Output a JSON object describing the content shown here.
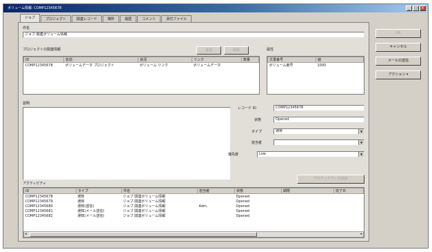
{
  "window": {
    "title": "ボリューム情報: COMP12345678"
  },
  "tabs": [
    {
      "label": "ジョブ"
    },
    {
      "label": "プロジェクト"
    },
    {
      "label": "関連レコード"
    },
    {
      "label": "場所"
    },
    {
      "label": "履歴"
    },
    {
      "label": "コメント"
    },
    {
      "label": "添付ファイル"
    }
  ],
  "main": {
    "subject_label": "件名",
    "subject_value": "ジョブ 関連ボリューム情報",
    "related_label": "プロジェクトの関連情報",
    "related_columns": [
      "ID",
      "名前",
      "状況",
      "リンク",
      "数量"
    ],
    "related_row": [
      "COMP12345678",
      "ボリュームデータ プロジェクト",
      "ボリューム リンク",
      "ボリュームデータ",
      ""
    ],
    "related_btn1": "追加",
    "related_btn2": "削除",
    "attr_label": "属性",
    "attr_col1": "文書番号",
    "attr_col2": "値",
    "attr_row": [
      "ボリューム番号",
      "1000"
    ],
    "desc_label": "説明",
    "form": {
      "record_id_label": "レコード ID",
      "record_id_value": "COMP12345678",
      "status_label": "状態",
      "status_value": "Opened",
      "type_label": "タイプ",
      "type_value": "通常",
      "owner_label": "担当者",
      "owner_value": "",
      "priority_label": "優先度",
      "priority_value": "Low"
    },
    "activity_label": "アクティビティ",
    "activity_btn": "アクティビティの追加",
    "activity_columns": [
      "ID",
      "タイプ",
      "件名",
      "担当者",
      "状態",
      "期限",
      "完了日"
    ],
    "activity_rows": [
      [
        "COMP12345678",
        "通知",
        "ジョブ 関連ボリューム情報",
        "",
        "Opened",
        "",
        ""
      ],
      [
        "COMP12345679",
        "通知",
        "ジョブ 関連ボリューム情報",
        "",
        "Opened",
        "",
        ""
      ],
      [
        "COMP12345680",
        "通知(送信)",
        "ジョブ 関連ボリューム情報",
        "Adm",
        "Opened",
        "",
        ""
      ],
      [
        "COMP12345681",
        "通知(メール送信)",
        "ジョブ 関連ボリューム情報",
        "",
        "Opened",
        "",
        ""
      ],
      [
        "COMP12345682",
        "通知(メール送信)",
        "ジョブ 関連ボリューム情報",
        "",
        "Opened",
        "",
        ""
      ]
    ]
  },
  "side": {
    "ok": "OK",
    "cancel": "キャンセル",
    "send": "メールの送信",
    "actions": "アクション ▾"
  }
}
